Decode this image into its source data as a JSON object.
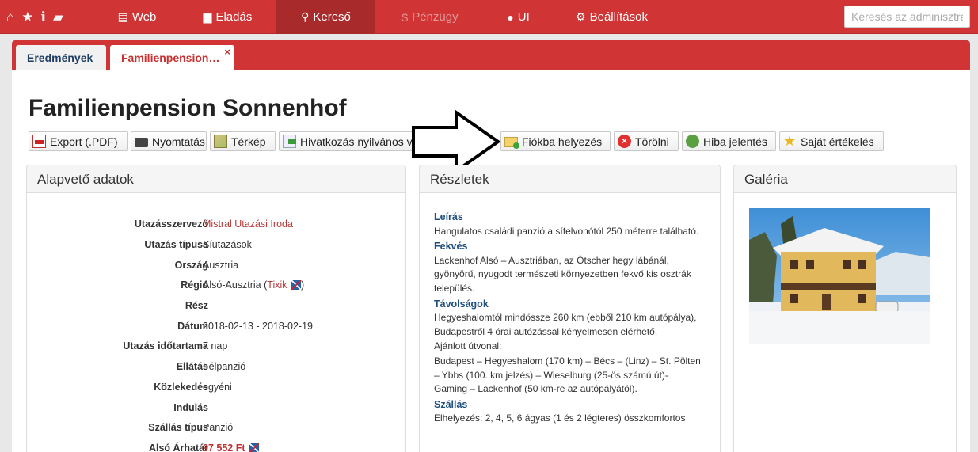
{
  "topbar": {
    "quick_icons": [
      {
        "icon": "home-icon",
        "glyph": "⌂"
      },
      {
        "icon": "star-icon",
        "glyph": "★"
      },
      {
        "icon": "info-icon",
        "glyph": "ℹ"
      },
      {
        "icon": "comment-icon",
        "glyph": "▰"
      }
    ],
    "nav": [
      {
        "label": "Web",
        "icon": "document-icon",
        "glyph": "▤"
      },
      {
        "label": "Eladás",
        "icon": "briefcase-icon",
        "glyph": "▆"
      },
      {
        "label": "Kereső",
        "icon": "search-icon",
        "glyph": "⚲",
        "active": true
      },
      {
        "label": "Pénzügy",
        "icon": "dollar-icon",
        "glyph": "$",
        "disabled": true
      },
      {
        "label": "UI",
        "icon": "globe-icon",
        "glyph": "●"
      },
      {
        "label": "Beállítások",
        "icon": "gear-icon",
        "glyph": "⚙"
      }
    ],
    "search_placeholder": "Keresés az adminisztrá"
  },
  "tabs": {
    "results": "Eredmények",
    "current": "Familienpension…",
    "close_glyph": "×"
  },
  "page_title": "Familienpension Sonnenhof",
  "toolbar": {
    "export": "Export (.PDF)",
    "print": "Nyomtatás",
    "map": "Térkép",
    "public_link": "Hivatkozás nyilvános v",
    "to_account": "Fiókba helyezés",
    "delete": "Törölni",
    "report_error": "Hiba jelentés",
    "my_rating": "Saját értékelés"
  },
  "basic": {
    "heading": "Alapvető adatok",
    "rows": [
      {
        "label": "Utazásszervező",
        "value": "Mistral Utazási Iroda"
      },
      {
        "label": "Utazás típusa",
        "value": "Síutazások"
      },
      {
        "label": "Ország",
        "value": "Ausztria"
      },
      {
        "label": "Régió",
        "value": "Alsó-Ausztria (",
        "link": "Tixik",
        "suffix": ")"
      },
      {
        "label": "Rész",
        "value": "--"
      },
      {
        "label": "Dátum",
        "value": "2018-02-13 - 2018-02-19"
      },
      {
        "label": "Utazás időtartama",
        "value": "7 nap"
      },
      {
        "label": "Ellátás",
        "value": "Félpanzió"
      },
      {
        "label": "Közlekedés",
        "value": "egyéni"
      },
      {
        "label": "Indulás",
        "value": "-"
      },
      {
        "label": "Szállás típus",
        "value": "Panzió"
      },
      {
        "label": "Alsó Árhatár",
        "value": "97 552 Ft"
      }
    ]
  },
  "details": {
    "heading": "Részletek",
    "sections": [
      {
        "title": "Leírás",
        "text": "Hangulatos családi panzió a sífelvonótól 250 méterre található."
      },
      {
        "title": "Fekvés",
        "text": "Lackenhof Alsó – Ausztriában, az Ötscher hegy lábánál, gyönyörű, nyugodt természeti környezetben fekvő kis osztrák település."
      },
      {
        "title": "Távolságok",
        "text": "Hegyeshalomtól mindössze 260 km (ebből 210 km autópálya), Budapestről 4 órai autózással kényelmesen elérhető.",
        "extra": "Ajánlott útvonal:",
        "extra2": "Budapest – Hegyeshalom (170 km) – Bécs – (Linz) – St. Pölten – Ybbs (100. km jelzés) – Wieselburg (25-ös számú út)- Gaming – Lackenhof (50 km-re az autópályától)."
      },
      {
        "title": "Szállás",
        "text": "Elhelyezés: 2, 4, 5, 6 ágyas (1 és 2 légteres) összkomfortos"
      }
    ]
  },
  "gallery": {
    "heading": "Galéria"
  }
}
